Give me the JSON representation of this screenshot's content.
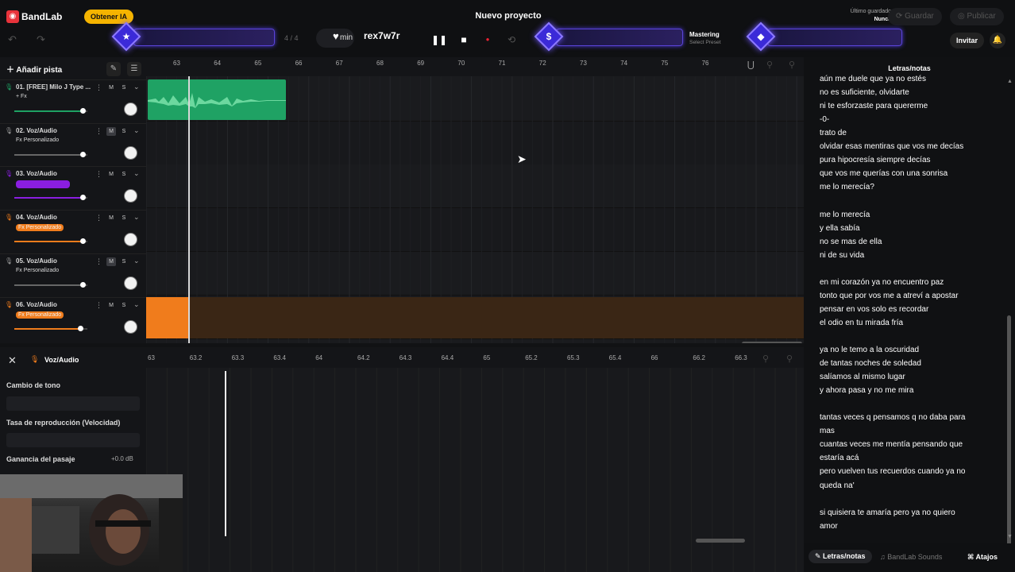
{
  "app": {
    "brand": "BandLab",
    "upgrade_label": "Obtener IA",
    "project_title": "Nuevo proyecto",
    "last_saved_label": "Último guardado",
    "last_saved_value": "Nunca",
    "save_label": "Guardar",
    "publish_label": "Publicar"
  },
  "toolbar": {
    "tempo_label": "min",
    "bar_counter": "4 / 4",
    "username": "rex7w7r",
    "mastering_label": "Mastering",
    "mastering_preset": "Select Preset",
    "invite_label": "Invitar",
    "accent_color": "#5a44d8"
  },
  "tracks_panel": {
    "add_track_label": "Añadir pista",
    "tracks": [
      {
        "name": "01. [FREE] Milo J Type ...",
        "fx": "+ Fx",
        "color": "#1fa264",
        "slider": 0.93,
        "fx_tag": false
      },
      {
        "name": "02. Voz/Audio",
        "fx": "Fx Personalizado",
        "color": "#999999",
        "slider": 0.93,
        "fx_tag": false
      },
      {
        "name": "03. Voz/Audio",
        "fx": "",
        "color": "#8a1ee0",
        "slider": 0.93,
        "fx_tag": true
      },
      {
        "name": "04. Voz/Audio",
        "fx": "Fx Personalizado",
        "color": "#f07c1c",
        "slider": 0.93,
        "fx_tag": true
      },
      {
        "name": "05. Voz/Audio",
        "fx": "Fx Personalizado",
        "color": "#999999",
        "slider": 0.93,
        "fx_tag": false
      },
      {
        "name": "06. Voz/Audio",
        "fx": "Fx Personalizado",
        "color": "#f07c1c",
        "slider": 0.9,
        "fx_tag": true
      }
    ],
    "mute_label": "M",
    "solo_label": "S"
  },
  "ruler": {
    "ticks": [
      "63",
      "64",
      "65",
      "66",
      "67",
      "68",
      "69",
      "70",
      "71",
      "72",
      "73",
      "74",
      "75",
      "76"
    ]
  },
  "editor": {
    "track_title": "Voz/Audio",
    "pitch_label": "Cambio de tono",
    "speed_label": "Tasa de reproducción (Velocidad)",
    "gain_label": "Ganancia del pasaje",
    "gain_value": "+0.0 dB",
    "ticks": [
      "63",
      "63.2",
      "63.3",
      "63.4",
      "64",
      "64.2",
      "64.3",
      "64.4",
      "65",
      "65.2",
      "65.3",
      "65.4",
      "66",
      "66.2",
      "66.3"
    ]
  },
  "lyrics": {
    "title": "Letras/notas",
    "lines": [
      "aún me duele que ya no estés",
      "no es suficiente, olvidarte",
      "ni te esforzaste para quererme",
      "-0-",
      "trato de",
      "olvidar esas mentiras que vos me decías",
      "pura hipocresía siempre decías",
      "que vos me querías con una sonrisa",
      "me lo merecía?",
      "",
      "me lo merecía",
      "y ella sabía",
      "no se mas de ella",
      "ni de su vida",
      "",
      "  en mi corazón ya no encuentro paz",
      "tonto que por vos me a  atreví a apostar",
      "pensar en vos solo es recordar",
      "el odio en tu mirada fría",
      "",
      "ya no le temo a la oscuridad",
      "de tantas noches de soledad",
      "salíamos al mismo lugar",
      "y ahora pasa y no me mira",
      "",
      "tantas veces q pensamos q no daba para",
      "mas",
      "cuantas  veces me mentía pensando que",
      "estaría acá",
      "pero vuelven tus recuerdos cuando ya no",
      "queda na'",
      "",
      "si quisiera te amaría pero ya no quiero",
      "amor"
    ]
  },
  "bottom_tabs": {
    "lyrics_tab": "Letras/notas",
    "sounds_tab": "BandLab Sounds",
    "shortcuts_tab": "Atajos"
  }
}
